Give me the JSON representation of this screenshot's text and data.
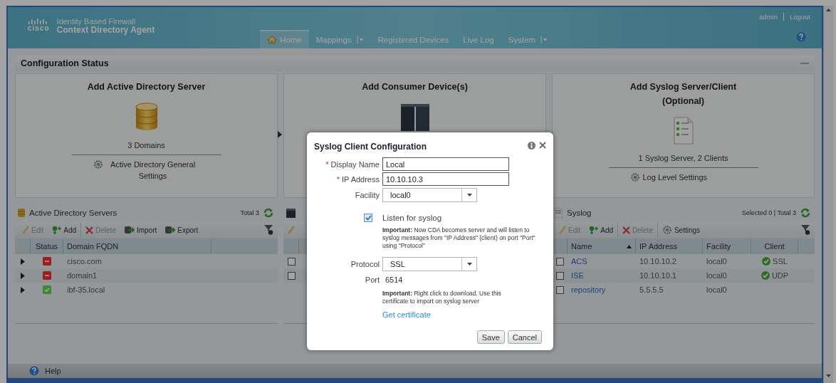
{
  "header": {
    "logo_text": "cisco",
    "subtitle": "Identity Based Firewall",
    "title": "Context Directory Agent",
    "nav": [
      {
        "label": "Home",
        "kind": "home",
        "selected": true
      },
      {
        "label": "Mappings",
        "kind": "menu",
        "selected": false
      },
      {
        "label": "Registered Devices",
        "kind": "plain",
        "selected": false
      },
      {
        "label": "Live Log",
        "kind": "plain",
        "selected": false
      },
      {
        "label": "System",
        "kind": "menu",
        "selected": false
      }
    ],
    "user": "admin",
    "logout": "Logout"
  },
  "section_title": "Configuration Status",
  "cards": [
    {
      "title": "Add Active Directory Server",
      "kind": "database",
      "summary": "3 Domains",
      "link": "Active Directory General Settings"
    },
    {
      "title": "Add Consumer Device(s)",
      "kind": "device"
    },
    {
      "title": "Add Syslog Server/Client (Optional)",
      "kind": "document",
      "summary": "1 Syslog Server, 2 Clients",
      "link": "Log Level Settings"
    }
  ],
  "ad_panel": {
    "title": "Active Directory Servers",
    "counts": "Total 3",
    "toolbar": [
      {
        "label": "Edit",
        "kind": "edit",
        "disabled": true
      },
      {
        "label": "Add",
        "kind": "add",
        "disabled": false
      },
      {
        "label": "Delete",
        "kind": "delete",
        "disabled": true
      },
      {
        "label": "Import",
        "kind": "import",
        "disabled": false
      },
      {
        "label": "Export",
        "kind": "export",
        "disabled": false
      }
    ],
    "columns": [
      "Status",
      "Domain FQDN"
    ],
    "rows": [
      {
        "domain": "cisco.com",
        "kind": "error",
        "color": "#9e1e20"
      },
      {
        "domain": "domain1",
        "kind": "error",
        "color": "#9e1e20"
      },
      {
        "domain": "ibf-35.local",
        "kind": "ok",
        "color": "#3c8a30"
      }
    ]
  },
  "device_panel": {
    "rows": [
      {
        "checked": false
      },
      {
        "checked": false
      }
    ]
  },
  "syslog_panel": {
    "title": "Syslog",
    "counts": "Selected 0 | Total 3",
    "toolbar": [
      {
        "label": "Edit",
        "kind": "edit",
        "disabled": true
      },
      {
        "label": "Add",
        "kind": "add",
        "disabled": false
      },
      {
        "label": "Delete",
        "kind": "delete",
        "disabled": true
      },
      {
        "label": "Settings",
        "kind": "settings",
        "disabled": false
      }
    ],
    "columns": [
      {
        "label": "Name",
        "sorted": true
      },
      {
        "label": "IP Address",
        "sorted": false
      },
      {
        "label": "Facility",
        "sorted": false
      },
      {
        "label": "Client",
        "sorted": false
      }
    ],
    "rows": [
      {
        "name": "ACS",
        "ip": "10.10.10.2",
        "facility": "local0",
        "client": "SSL",
        "checked": false
      },
      {
        "name": "ISE",
        "ip": "10.10.10.1",
        "facility": "local0",
        "client": "UDP",
        "checked": false
      },
      {
        "name": "repository",
        "ip": "5.5.5.5",
        "facility": "local0",
        "checked": false
      }
    ]
  },
  "footer": {
    "help": "Help"
  },
  "dialog": {
    "title": "Syslog Client Configuration",
    "fields": [
      {
        "label": "Display Name",
        "kind": "text",
        "required_mark": "*",
        "value": "Local"
      },
      {
        "label": "IP Address",
        "kind": "text",
        "required_mark": "*",
        "value": "10.10.10.3"
      },
      {
        "label": "Facility",
        "kind": "select",
        "value": "local0"
      }
    ],
    "listen": {
      "label": "Listen for syslog",
      "checked": true
    },
    "note1": "**Important:** Now CDA becomes server and will listen to syslog messages from \"IP Address\" (client) on port \"Port\" using \"Protocol\"",
    "protocol": {
      "label": "Protocol",
      "value": "SSL"
    },
    "port": {
      "label": "Port",
      "value": "6514"
    },
    "note2": "**Important:** Right click to download. Use this certificate to import on syslog server",
    "link": "Get certificate",
    "buttons": [
      "Save",
      "Cancel"
    ]
  }
}
